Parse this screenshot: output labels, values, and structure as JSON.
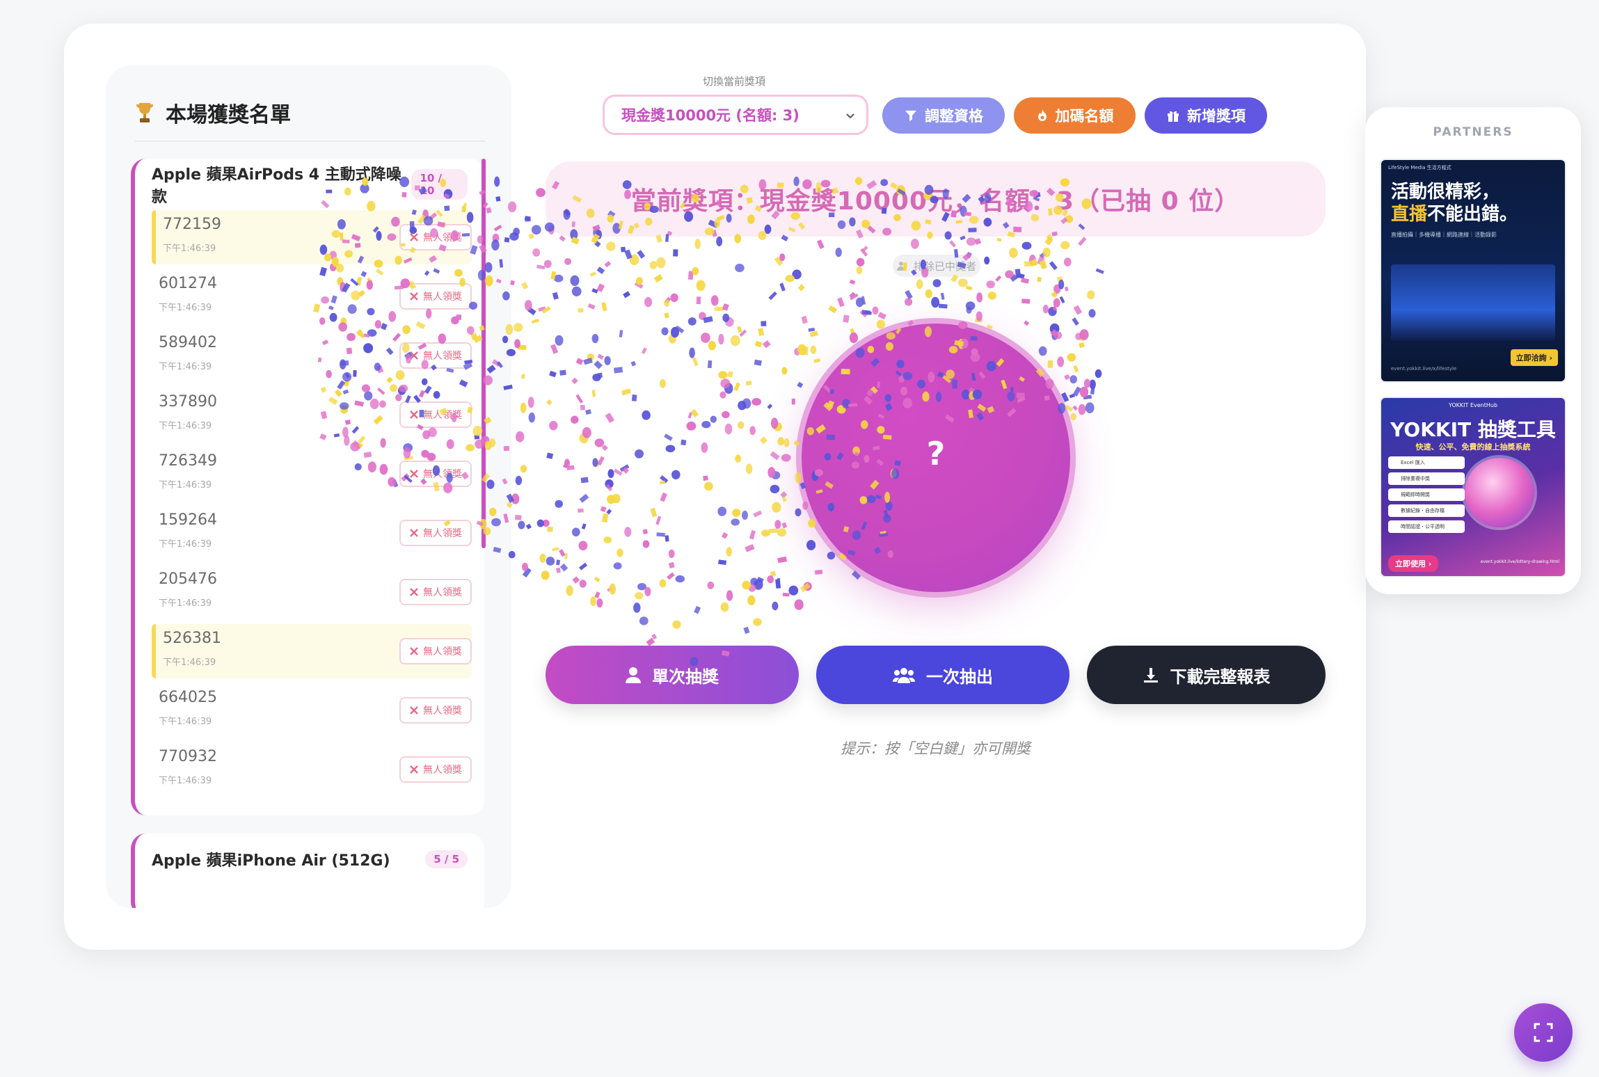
{
  "winners_panel": {
    "title": "本場獲獎名單",
    "groups": [
      {
        "name": "Apple 蘋果AirPods 4 主動式降噪款",
        "count": "10 / 10",
        "entries": [
          {
            "id": "772159",
            "time": "下午1:46:39",
            "status": "無人領獎",
            "highlight": true
          },
          {
            "id": "601274",
            "time": "下午1:46:39",
            "status": "無人領獎",
            "highlight": false
          },
          {
            "id": "589402",
            "time": "下午1:46:39",
            "status": "無人領獎",
            "highlight": false
          },
          {
            "id": "337890",
            "time": "下午1:46:39",
            "status": "無人領獎",
            "highlight": false
          },
          {
            "id": "726349",
            "time": "下午1:46:39",
            "status": "無人領獎",
            "highlight": false
          },
          {
            "id": "159264",
            "time": "下午1:46:39",
            "status": "無人領獎",
            "highlight": false
          },
          {
            "id": "205476",
            "time": "下午1:46:39",
            "status": "無人領獎",
            "highlight": false
          },
          {
            "id": "526381",
            "time": "下午1:46:39",
            "status": "無人領獎",
            "highlight": true
          },
          {
            "id": "664025",
            "time": "下午1:46:39",
            "status": "無人領獎",
            "highlight": false
          },
          {
            "id": "770932",
            "time": "下午1:46:39",
            "status": "無人領獎",
            "highlight": false
          }
        ]
      },
      {
        "name": "Apple 蘋果iPhone Air (512G)",
        "count": "5 / 5"
      }
    ]
  },
  "controls": {
    "select_label": "切換當前獎項",
    "selected_prize": "現金獎10000元 (名額: 3)",
    "filter_label": "調整資格",
    "bonus_label": "加碼名額",
    "add_label": "新增獎項"
  },
  "current_prize_text": "當前獎項：現金獎10000元，名額：3（已抽 0 位）",
  "exclude_label": "排除已中獎者",
  "ball_text": "?",
  "actions": {
    "single": "單次抽獎",
    "batch": "一次抽出",
    "download": "下載完整報表"
  },
  "hint": "提示：按「空白鍵」亦可開獎",
  "partners": {
    "label": "PARTNERS",
    "ad1": {
      "tag": "LifeStyle Media 生活方程式",
      "title_line1": "活動很精彩，",
      "title_line2_highlight": "直播",
      "title_line2_rest": "不能出錯。",
      "sub": "直播拍攝｜多機導播｜網路連線｜活動錄影",
      "cta": "立即洽詢 ›",
      "url": "event.yokkit.live/x/lifestyle"
    },
    "ad2": {
      "badge": "YOKKIT EventHub",
      "title": "YOKKIT 抽獎工具",
      "sub": "快速、公平、免費的線上抽獎系統",
      "features": [
        "Excel 匯入",
        "排除重複中獎",
        "規範即時開獎",
        "數據紀錄・自由存檔",
        "時間認證・公平透明"
      ],
      "cta": "立即使用 ›",
      "url": "event.yokkit.live/lottery-drawing.html"
    }
  },
  "colors": {
    "accent_pink": "#c94fc0",
    "filter_button": "#8d93ee",
    "bonus_button": "#ee7e34",
    "add_button": "#6157e3",
    "batch_button": "#4b46dc",
    "download_button": "#1f2430",
    "confetti": [
      "#e070c8",
      "#f5d742",
      "#5a55d8"
    ]
  },
  "icons": {
    "trophy": "trophy-icon",
    "filter": "filter-icon",
    "fire": "fire-icon",
    "gift": "gift-icon",
    "user": "user-icon",
    "users": "users-icon",
    "download": "download-icon",
    "close": "close-icon",
    "fullscreen": "fullscreen-icon"
  }
}
